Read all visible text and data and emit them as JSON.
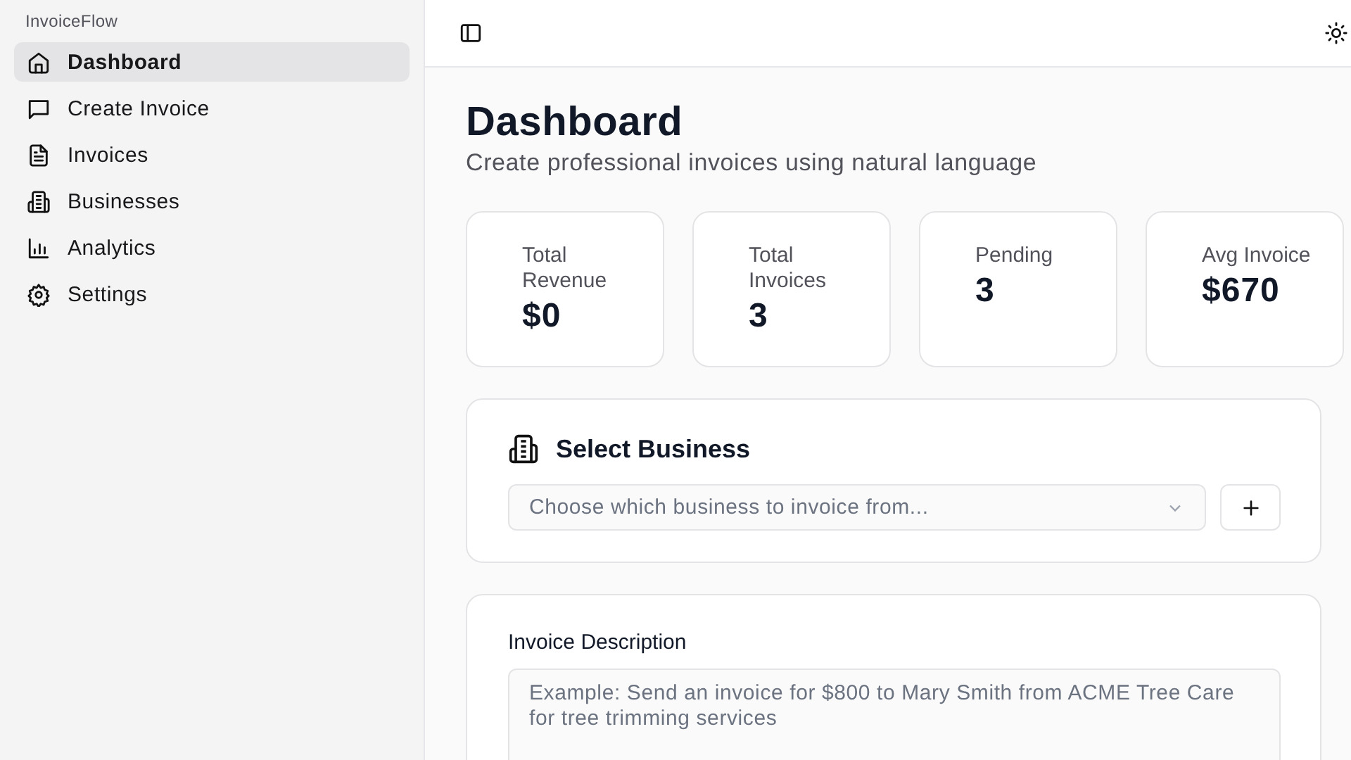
{
  "sidebar": {
    "brand": "InvoiceFlow",
    "items": [
      {
        "label": "Dashboard",
        "selected": true
      },
      {
        "label": "Create Invoice",
        "selected": false
      },
      {
        "label": "Invoices",
        "selected": false
      },
      {
        "label": "Businesses",
        "selected": false
      },
      {
        "label": "Analytics",
        "selected": false
      },
      {
        "label": "Settings",
        "selected": false
      }
    ]
  },
  "page": {
    "title": "Dashboard",
    "subtitle": "Create professional invoices using natural language"
  },
  "stats": [
    {
      "label": "Total Revenue",
      "value": "$0"
    },
    {
      "label": "Total Invoices",
      "value": "3"
    },
    {
      "label": "Pending",
      "value": "3"
    },
    {
      "label": "Avg Invoice",
      "value": "$670"
    }
  ],
  "business": {
    "title": "Select Business",
    "placeholder": "Choose which business to invoice from..."
  },
  "description": {
    "label": "Invoice Description",
    "placeholder": "Example: Send an invoice for $800 to Mary Smith from ACME Tree Care for tree trimming services"
  }
}
